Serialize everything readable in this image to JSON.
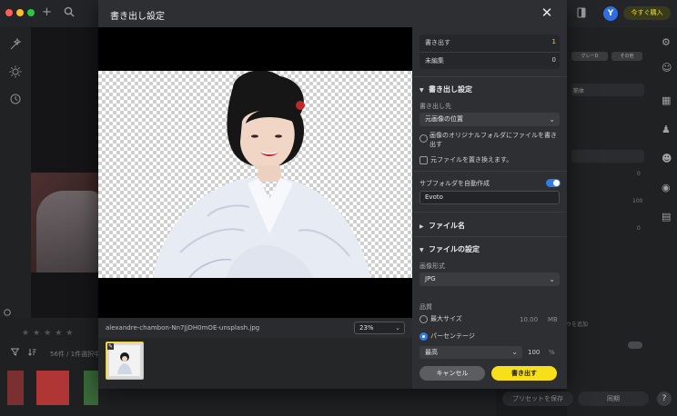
{
  "dialog": {
    "title": "書き出し設定",
    "close_icon": "close-icon"
  },
  "preview": {
    "filename": "alexandre-chambon-Nn7JjDH0mOE-unsplash.jpg",
    "zoom": "23%"
  },
  "counts": {
    "export_label": "書き出す",
    "export_count": "1",
    "unedited_label": "未編集",
    "unedited_count": "0"
  },
  "export_settings": {
    "section_title": "書き出し設定",
    "destination_label": "書き出し先",
    "destination_value": "元画像の位置",
    "radio_original_folder": "画像のオリジナルフォルダにファイルを書き出す",
    "overwrite_label": "元ファイルを置き換えます。",
    "subfolder_label": "サブフォルダを自動作成",
    "subfolder_value": "Evoto"
  },
  "filename_section": {
    "title": "ファイル名"
  },
  "file_settings": {
    "section_title": "ファイルの設定",
    "format_label": "画像形式",
    "format_value": "JPG",
    "quality_label": "品質",
    "max_size_label": "最大サイズ",
    "max_size_value": "10.00",
    "max_size_unit": "MB",
    "percentage_label": "パーセンテージ",
    "quality_preset": "最高",
    "quality_value": "100",
    "quality_unit": "%"
  },
  "actions": {
    "cancel": "キャンセル",
    "export": "書き出す"
  },
  "background": {
    "avatar_letter": "Y",
    "buy_button": "今すぐ購入",
    "selection_count": "56件 / 1件選択中",
    "preset_button": "プリセットを保存",
    "sync_button": "同期",
    "help": "?",
    "panel_pill_1": "グレーD",
    "panel_pill_2": "その他",
    "panel_row_label": "筋体",
    "panel_num_1": "0",
    "panel_num_2": "100",
    "panel_num_3": "0",
    "sync_hint": "ウを追加"
  },
  "colors": {
    "accent_blue": "#2f7be8",
    "export_yellow": "#f7e019",
    "count_yellow": "#e8d33a",
    "dialog_bg": "#2e2f32"
  }
}
